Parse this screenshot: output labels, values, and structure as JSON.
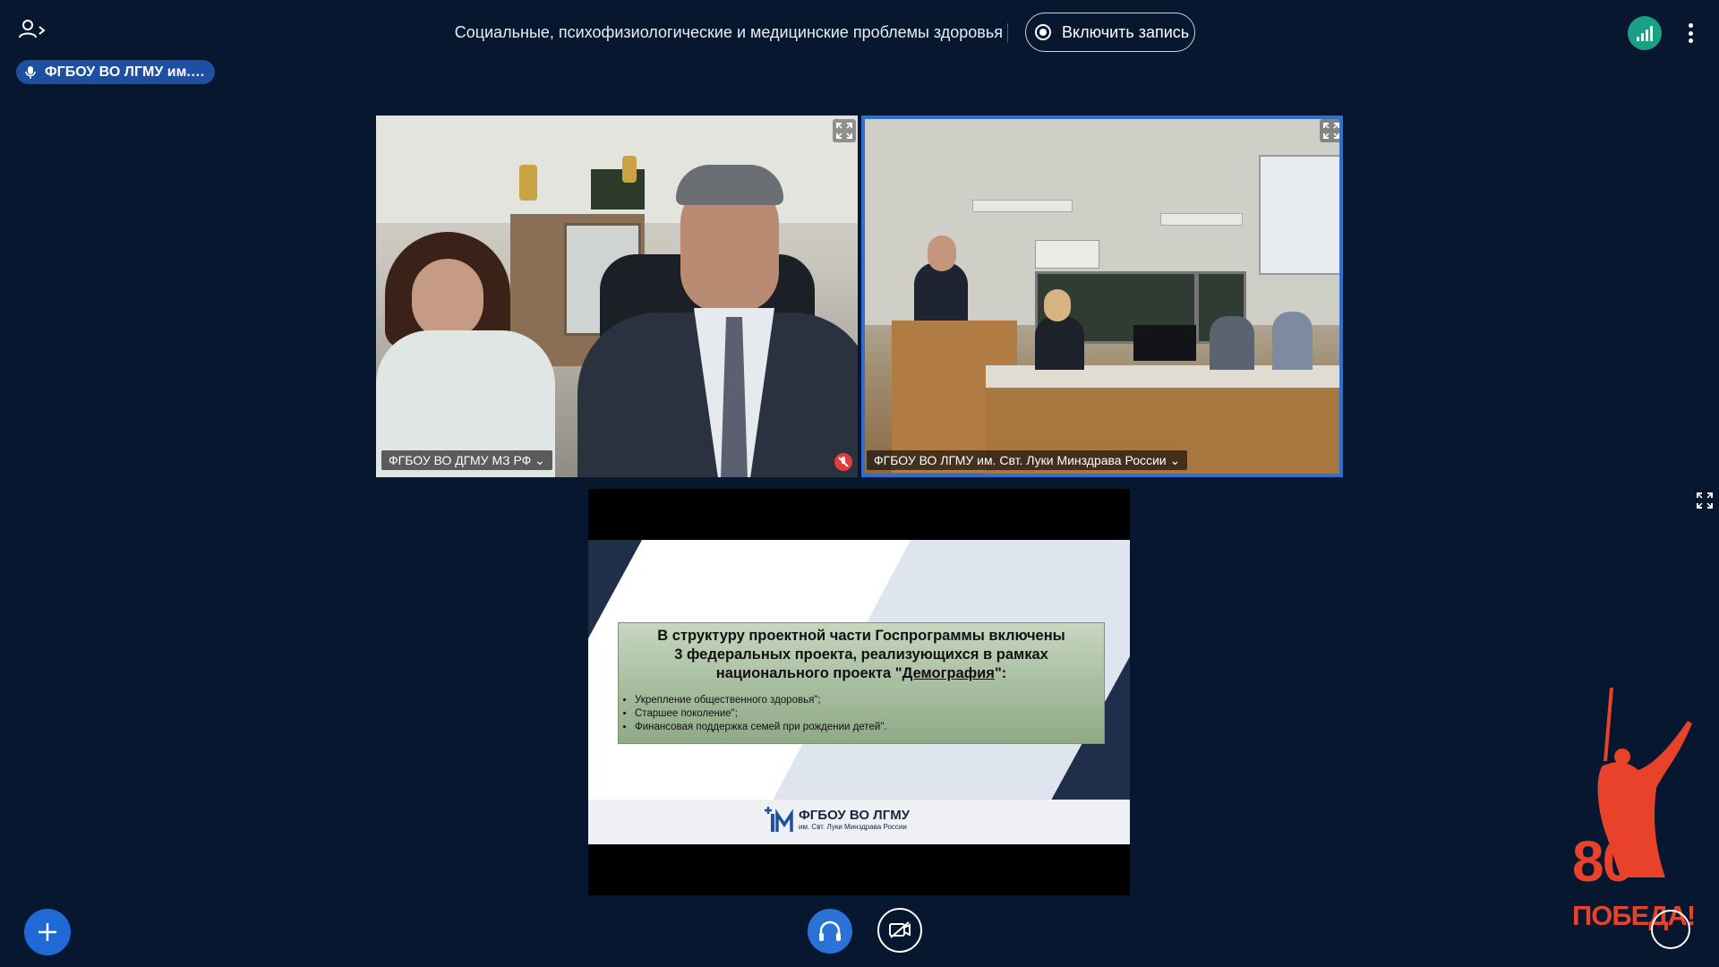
{
  "header": {
    "title": "Социальные, психофизиологические и медицинские проблемы здоровья",
    "record_label": "Включить запись",
    "speaker": "ФГБОУ ВО ЛГМУ им. Свт. Луки Минздрава России"
  },
  "videos": [
    {
      "label": "ФГБОУ ВО ДГМУ МЗ РФ",
      "muted": true
    },
    {
      "label": "ФГБОУ ВО ЛГМУ им. Свт. Луки Минздрава России",
      "active": true
    }
  ],
  "slide": {
    "headline_1": "В структуру проектной части Госпрограммы включены",
    "headline_2": "3 федеральных проекта, реализующихся в рамках",
    "headline_3_prefix": "национального проекта \"",
    "headline_3_link": "Демография",
    "headline_3_suffix": "\":",
    "bullets": [
      "Укрепление общественного здоровья\";",
      "Старшее поколение\";",
      "Финансовая поддержка семей при рождении детей\"."
    ],
    "logo_title": "ФГБОУ ВО ЛГМУ",
    "logo_subtitle": "им. Свт. Луки Минздрава России"
  },
  "victory_badge": {
    "number": "80",
    "word": "ПОБЕДА!"
  },
  "colors": {
    "background": "#06172f",
    "accent_blue": "#2f6fd1",
    "signal_green": "#1aa085",
    "badge_red": "#e8432a"
  },
  "icons": {
    "users": "users-icon",
    "record": "record-icon",
    "signal": "signal-icon",
    "menu": "kebab-menu-icon",
    "expand": "expand-icon",
    "plus": "plus-icon",
    "headphones": "headphones-icon",
    "camera_off": "camera-off-icon"
  }
}
